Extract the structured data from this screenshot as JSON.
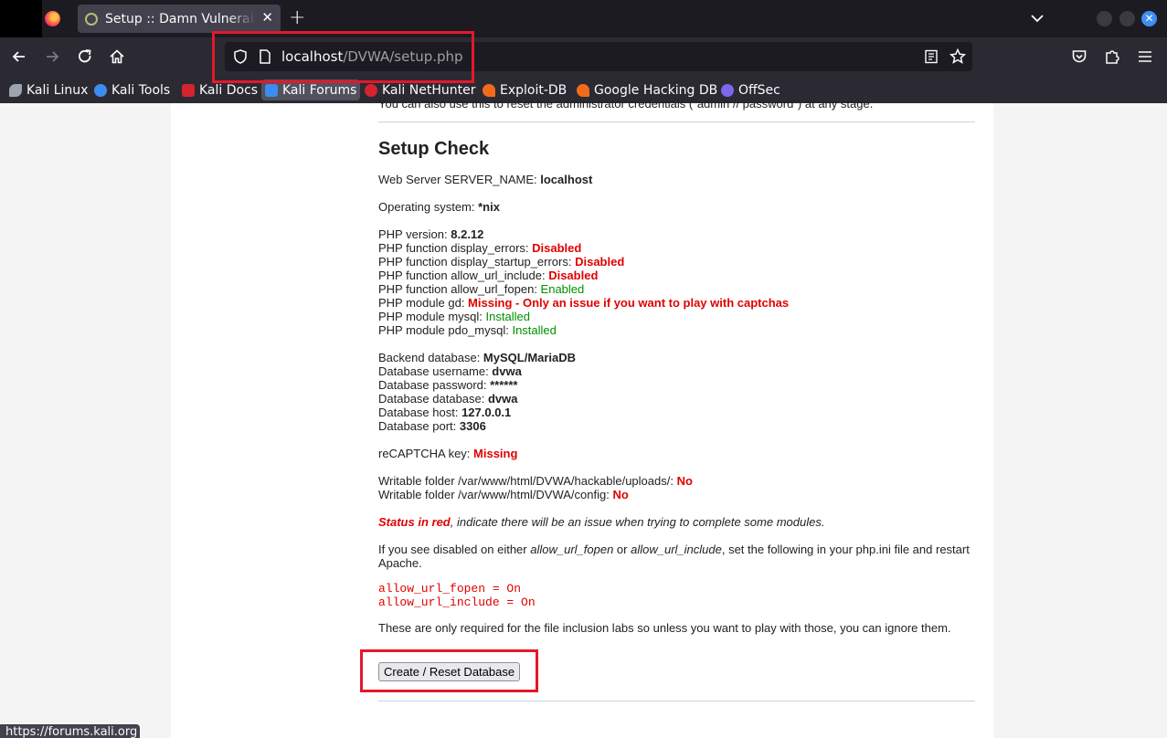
{
  "browser": {
    "tab_title": "Setup :: Damn Vulnerable Web Application",
    "url_host": "localhost",
    "url_path": "/DVWA/setup.php",
    "status_url": "https://forums.kali.org"
  },
  "bookmarks": [
    {
      "label": "Kali Linux",
      "icon": "kali-dragon-icon",
      "color": "#9ea3ad"
    },
    {
      "label": "Kali Tools",
      "icon": "kali-tools-icon",
      "color": "#3d8cf0"
    },
    {
      "label": "Kali Docs",
      "icon": "kali-docs-icon",
      "color": "#d3242f"
    },
    {
      "label": "Kali Forums",
      "icon": "kali-forums-icon",
      "color": "#3d8cf0"
    },
    {
      "label": "Kali NetHunter",
      "icon": "nethunter-icon",
      "color": "#d3242f"
    },
    {
      "label": "Exploit-DB",
      "icon": "exploit-db-icon",
      "color": "#f26b1d"
    },
    {
      "label": "Google Hacking DB",
      "icon": "ghdb-icon",
      "color": "#f26b1d"
    },
    {
      "label": "OffSec",
      "icon": "offsec-icon",
      "color": "#7b68ee"
    }
  ],
  "page": {
    "cut_line": "You can also use this to reset the administrator credentials (\"admin // password\") at any stage.",
    "heading": "Setup Check",
    "server_name_label": "Web Server SERVER_NAME: ",
    "server_name": "localhost",
    "os_label": "Operating system: ",
    "os": "*nix",
    "php_version_label": "PHP version: ",
    "php_version": "8.2.12",
    "display_errors_label": "PHP function display_errors: ",
    "display_errors": "Disabled",
    "display_startup_errors_label": "PHP function display_startup_errors: ",
    "display_startup_errors": "Disabled",
    "allow_url_include_label": "PHP function allow_url_include: ",
    "allow_url_include": "Disabled",
    "allow_url_fopen_label": "PHP function allow_url_fopen: ",
    "allow_url_fopen": "Enabled",
    "gd_label": "PHP module gd: ",
    "gd": "Missing - Only an issue if you want to play with captchas",
    "mysql_label": "PHP module mysql: ",
    "mysql": "Installed",
    "pdo_mysql_label": "PHP module pdo_mysql: ",
    "pdo_mysql": "Installed",
    "backend_label": "Backend database: ",
    "backend": "MySQL/MariaDB",
    "db_user_label": "Database username: ",
    "db_user": "dvwa",
    "db_pass_label": "Database password: ",
    "db_pass": "******",
    "db_name_label": "Database database: ",
    "db_name": "dvwa",
    "db_host_label": "Database host: ",
    "db_host": "127.0.0.1",
    "db_port_label": "Database port: ",
    "db_port": "3306",
    "recaptcha_label": "reCAPTCHA key: ",
    "recaptcha": "Missing",
    "uploads_label": "Writable folder /var/www/html/DVWA/hackable/uploads/: ",
    "uploads": "No",
    "config_label": "Writable folder /var/www/html/DVWA/config: ",
    "config": "No",
    "status_red": "Status in red",
    "status_rest": ", indicate there will be an issue when trying to complete some modules.",
    "disabled_p1": "If you see disabled on either ",
    "disabled_fopen": "allow_url_fopen",
    "disabled_or": " or ",
    "disabled_include": "allow_url_include",
    "disabled_p2": ", set the following in your php.ini file and restart",
    "disabled_p3": "Apache.",
    "code_line1": "allow_url_fopen = On",
    "code_line2": "allow_url_include = On",
    "only_required": "These are only required for the file inclusion labs so unless you want to play with those, you can ignore them.",
    "button_label": "Create / Reset Database"
  }
}
